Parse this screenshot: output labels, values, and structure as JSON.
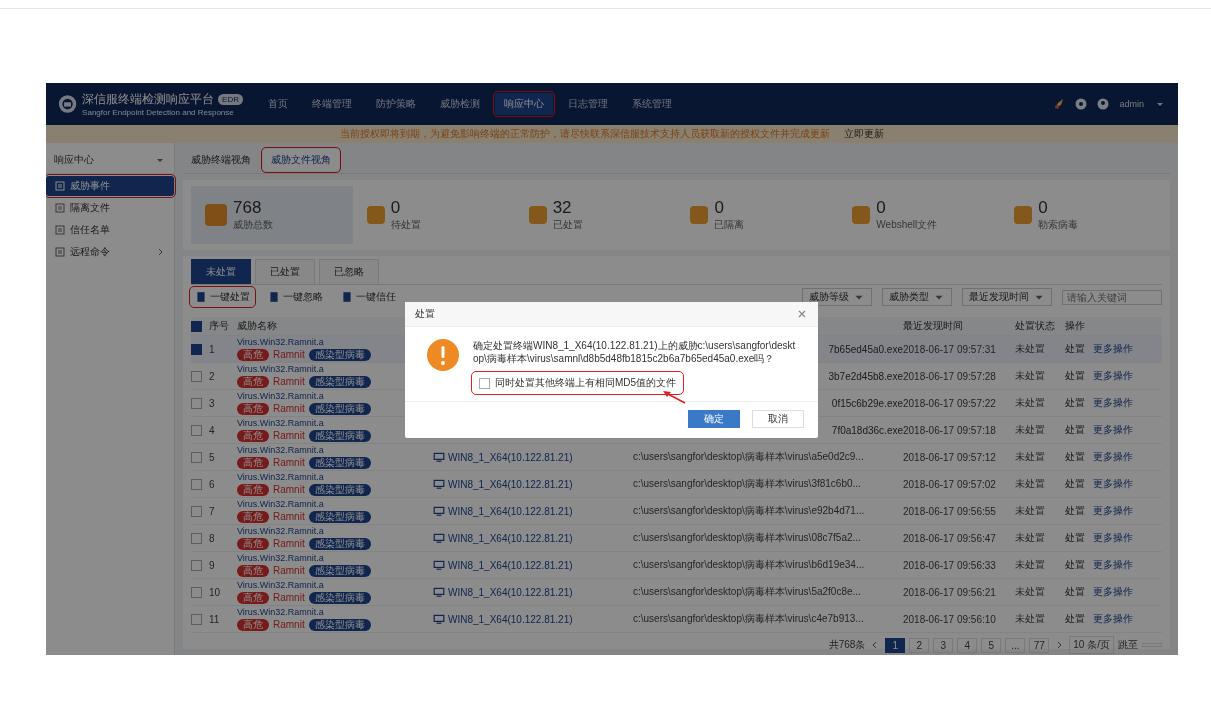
{
  "header": {
    "logo_title": "深信服终端检测响应平台",
    "logo_badge": "EDR",
    "logo_subtitle": "Sangfor Endpoint Detection and Response",
    "nav": [
      {
        "label": "首页",
        "selected": false,
        "annotated": false
      },
      {
        "label": "终端管理",
        "selected": false,
        "annotated": false
      },
      {
        "label": "防护策略",
        "selected": false,
        "annotated": false
      },
      {
        "label": "威胁检测",
        "selected": false,
        "annotated": false
      },
      {
        "label": "响应中心",
        "selected": true,
        "annotated": true
      },
      {
        "label": "日志管理",
        "selected": false,
        "annotated": false
      },
      {
        "label": "系统管理",
        "selected": false,
        "annotated": false
      }
    ],
    "user": "admin"
  },
  "notice": {
    "text": "当前授权即将到期，为避免影响终端的正常防护，请尽快联系深信服技术支持人员获取新的授权文件并完成更新",
    "link": "立即更新"
  },
  "sidebar": {
    "title": "响应中心",
    "items": [
      {
        "label": "威胁事件",
        "selected": true,
        "annotated": true,
        "expandable": false
      },
      {
        "label": "隔离文件",
        "selected": false,
        "annotated": false,
        "expandable": false
      },
      {
        "label": "信任名单",
        "selected": false,
        "annotated": false,
        "expandable": false
      },
      {
        "label": "远程命令",
        "selected": false,
        "annotated": false,
        "expandable": true
      }
    ]
  },
  "view_tabs": [
    {
      "label": "威胁终端视角",
      "selected": false,
      "annotated": false
    },
    {
      "label": "威胁文件视角",
      "selected": true,
      "annotated": true
    }
  ],
  "stats": [
    {
      "value": "768",
      "label": "威胁总数",
      "selected": true
    },
    {
      "value": "0",
      "label": "待处置",
      "selected": false
    },
    {
      "value": "32",
      "label": "已处置",
      "selected": false
    },
    {
      "value": "0",
      "label": "已隔离",
      "selected": false
    },
    {
      "value": "0",
      "label": "Webshell文件",
      "selected": false
    },
    {
      "value": "0",
      "label": "勒索病毒",
      "selected": false
    }
  ],
  "status_tabs": [
    {
      "label": "未处置",
      "selected": true
    },
    {
      "label": "已处置",
      "selected": false
    },
    {
      "label": "已忽略",
      "selected": false
    }
  ],
  "toolbar": {
    "actions": [
      {
        "label": "一键处置",
        "annotated": true
      },
      {
        "label": "一键忽略",
        "annotated": false
      },
      {
        "label": "一键信任",
        "annotated": false
      }
    ],
    "filters": [
      "威胁等级",
      "威胁类型",
      "最近发现时间"
    ],
    "search": {
      "placeholder": "请输入关键词"
    }
  },
  "table": {
    "select_all_checked": true,
    "columns": {
      "index": "序号",
      "name": "威胁名称",
      "time": "最近发现时间",
      "status": "处置状态",
      "actions": "操作"
    },
    "rows": [
      {
        "index": "1",
        "checked": true,
        "name": "Virus.Win32.Ramnit.a",
        "level": "高危",
        "family": "Ramnit",
        "type": "感染型病毒",
        "path_tail": "7b65ed45a0.exe",
        "time": "2018-06-17 09:57:31",
        "status": "未处置",
        "action": "处置",
        "more": "更多操作"
      },
      {
        "index": "2",
        "checked": false,
        "name": "Virus.Win32.Ramnit.a",
        "level": "高危",
        "family": "Ramnit",
        "type": "感染型病毒",
        "path_tail": "3b7e2d45b8.exe",
        "time": "2018-06-17 09:57:28",
        "status": "未处置",
        "action": "处置",
        "more": "更多操作"
      },
      {
        "index": "3",
        "checked": false,
        "name": "Virus.Win32.Ramnit.a",
        "level": "高危",
        "family": "Ramnit",
        "type": "感染型病毒",
        "path_tail": "0f15c6b29e.exe",
        "time": "2018-06-17 09:57:22",
        "status": "未处置",
        "action": "处置",
        "more": "更多操作"
      },
      {
        "index": "4",
        "checked": false,
        "name": "Virus.Win32.Ramnit.a",
        "level": "高危",
        "family": "Ramnit",
        "type": "感染型病毒",
        "path_tail": "7f0a18d36c.exe",
        "time": "2018-06-17 09:57:18",
        "status": "未处置",
        "action": "处置",
        "more": "更多操作"
      },
      {
        "index": "5",
        "checked": false,
        "name": "Virus.Win32.Ramnit.a",
        "level": "高危",
        "family": "Ramnit",
        "type": "感染型病毒",
        "terminal": "WIN8_1_X64(10.122.81.21)",
        "path": "c:\\users\\sangfor\\desktop\\病毒样本\\virus\\a5e0d2c9...",
        "time": "2018-06-17 09:57:12",
        "status": "未处置",
        "action": "处置",
        "more": "更多操作"
      },
      {
        "index": "6",
        "checked": false,
        "name": "Virus.Win32.Ramnit.a",
        "level": "高危",
        "family": "Ramnit",
        "type": "感染型病毒",
        "terminal": "WIN8_1_X64(10.122.81.21)",
        "path": "c:\\users\\sangfor\\desktop\\病毒样本\\virus\\3f81c6b0...",
        "time": "2018-06-17 09:57:02",
        "status": "未处置",
        "action": "处置",
        "more": "更多操作"
      },
      {
        "index": "7",
        "checked": false,
        "name": "Virus.Win32.Ramnit.a",
        "level": "高危",
        "family": "Ramnit",
        "type": "感染型病毒",
        "terminal": "WIN8_1_X64(10.122.81.21)",
        "path": "c:\\users\\sangfor\\desktop\\病毒样本\\virus\\e92b4d71...",
        "time": "2018-06-17 09:56:55",
        "status": "未处置",
        "action": "处置",
        "more": "更多操作"
      },
      {
        "index": "8",
        "checked": false,
        "name": "Virus.Win32.Ramnit.a",
        "level": "高危",
        "family": "Ramnit",
        "type": "感染型病毒",
        "terminal": "WIN8_1_X64(10.122.81.21)",
        "path": "c:\\users\\sangfor\\desktop\\病毒样本\\virus\\08c7f5a2...",
        "time": "2018-06-17 09:56:47",
        "status": "未处置",
        "action": "处置",
        "more": "更多操作"
      },
      {
        "index": "9",
        "checked": false,
        "name": "Virus.Win32.Ramnit.a",
        "level": "高危",
        "family": "Ramnit",
        "type": "感染型病毒",
        "terminal": "WIN8_1_X64(10.122.81.21)",
        "path": "c:\\users\\sangfor\\desktop\\病毒样本\\virus\\b6d19e34...",
        "time": "2018-06-17 09:56:33",
        "status": "未处置",
        "action": "处置",
        "more": "更多操作"
      },
      {
        "index": "10",
        "checked": false,
        "name": "Virus.Win32.Ramnit.a",
        "level": "高危",
        "family": "Ramnit",
        "type": "感染型病毒",
        "terminal": "WIN8_1_X64(10.122.81.21)",
        "path": "c:\\users\\sangfor\\desktop\\病毒样本\\virus\\5a2f0c8e...",
        "time": "2018-06-17 09:56:21",
        "status": "未处置",
        "action": "处置",
        "more": "更多操作"
      },
      {
        "index": "11",
        "checked": false,
        "name": "Virus.Win32.Ramnit.a",
        "level": "高危",
        "family": "Ramnit",
        "type": "感染型病毒",
        "terminal": "WIN8_1_X64(10.122.81.21)",
        "path": "c:\\users\\sangfor\\desktop\\病毒样本\\virus\\c4e7b913...",
        "time": "2018-06-17 09:56:10",
        "status": "未处置",
        "action": "处置",
        "more": "更多操作"
      }
    ]
  },
  "pagination": {
    "total": "共768条",
    "pages": [
      {
        "label": "1",
        "selected": true
      },
      {
        "label": "2",
        "selected": false
      },
      {
        "label": "3",
        "selected": false
      },
      {
        "label": "4",
        "selected": false
      },
      {
        "label": "5",
        "selected": false
      },
      {
        "label": "...",
        "selected": false
      },
      {
        "label": "77",
        "selected": false
      }
    ],
    "page_size": "10 条/页",
    "jump": "跳至"
  },
  "dialog": {
    "title": "处置",
    "message": "确定处置终端WIN8_1_X64(10.122.81.21)上的威胁c:\\users\\sangfor\\desktop\\病毒样本\\virus\\samnl\\d8b5d48fb1815c2b6a7b65ed45a0.exe吗？",
    "checkbox": {
      "label": "同时处置其他终端上有相同MD5值的文件",
      "checked": false,
      "annotated": true
    },
    "buttons": [
      {
        "label": "确定",
        "kind": "primary"
      },
      {
        "label": "取消",
        "kind": "default"
      }
    ]
  }
}
